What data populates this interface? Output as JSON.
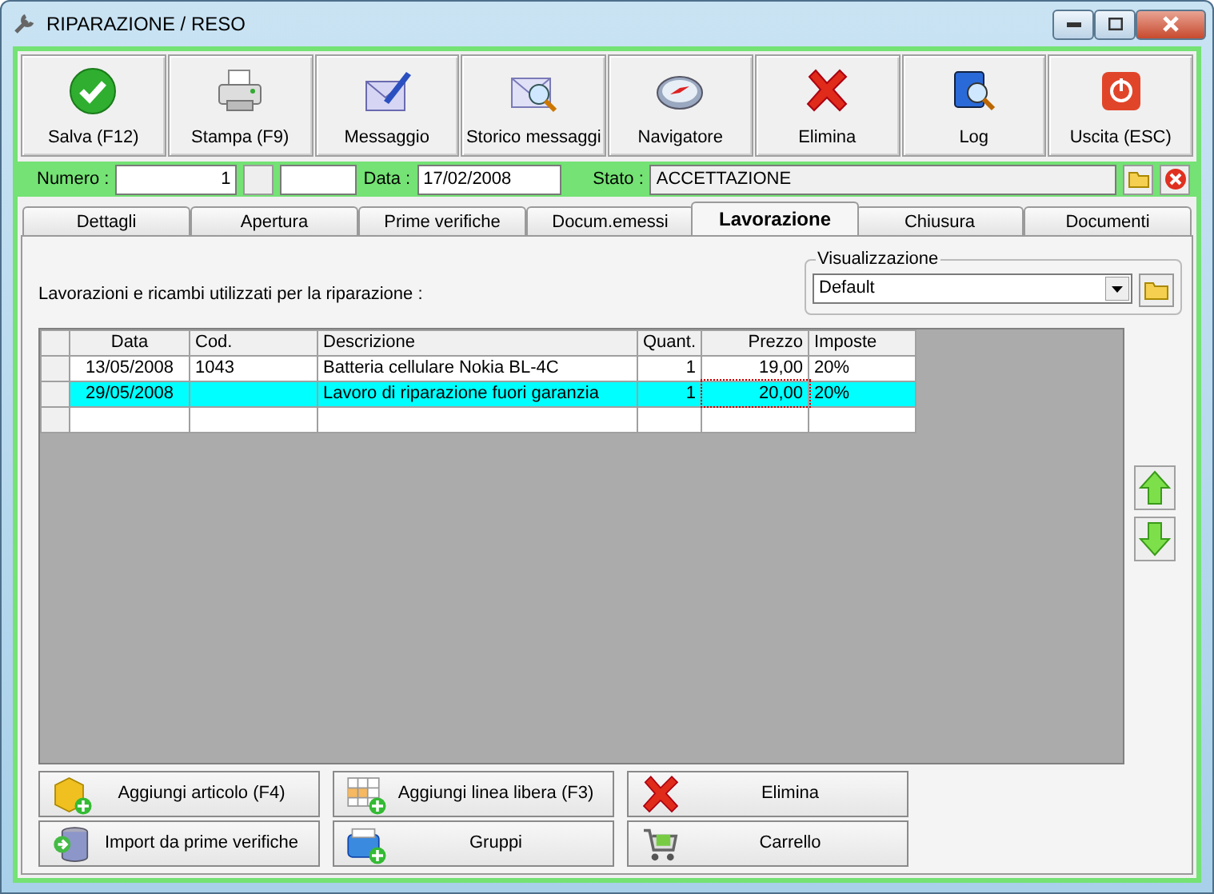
{
  "window": {
    "title": "RIPARAZIONE / RESO"
  },
  "toolbar": [
    {
      "label": "Salva (F12)",
      "kind": "check"
    },
    {
      "label": "Stampa (F9)",
      "kind": "printer"
    },
    {
      "label": "Messaggio",
      "kind": "mail-pen"
    },
    {
      "label": "Storico messaggi",
      "kind": "mail-search"
    },
    {
      "label": "Navigatore",
      "kind": "compass"
    },
    {
      "label": "Elimina",
      "kind": "cross"
    },
    {
      "label": "Log",
      "kind": "book-search"
    },
    {
      "label": "Uscita (ESC)",
      "kind": "power"
    }
  ],
  "record": {
    "numero_label": "Numero :",
    "numero": "1",
    "data_label": "Data :",
    "data": "17/02/2008",
    "stato_label": "Stato :",
    "stato": "ACCETTAZIONE"
  },
  "tabs": [
    {
      "label": "Dettagli",
      "selected": false
    },
    {
      "label": "Apertura",
      "selected": false
    },
    {
      "label": "Prime verifiche",
      "selected": false
    },
    {
      "label": "Docum.emessi",
      "selected": false
    },
    {
      "label": "Lavorazione",
      "selected": true
    },
    {
      "label": "Chiusura",
      "selected": false
    },
    {
      "label": "Documenti",
      "selected": false
    }
  ],
  "caption": "Lavorazioni e ricambi utilizzati per la riparazione :",
  "view": {
    "legend": "Visualizzazione",
    "value": "Default"
  },
  "table": {
    "columns": [
      "Data",
      "Cod.",
      "Descrizione",
      "Quant.",
      "Prezzo",
      "Imposte"
    ],
    "rows": [
      {
        "cells": [
          "13/05/2008",
          "1043",
          "Batteria cellulare Nokia BL-4C",
          "1",
          "19,00",
          "20%"
        ],
        "selected": false
      },
      {
        "cells": [
          "29/05/2008",
          "",
          "Lavoro di riparazione fuori garanzia",
          "1",
          "20,00",
          "20%"
        ],
        "selected": true
      }
    ]
  },
  "actions": [
    {
      "label": "Aggiungi articolo (F4)",
      "kind": "box-add"
    },
    {
      "label": "Aggiungi linea libera (F3)",
      "kind": "grid-add"
    },
    {
      "label": "Elimina",
      "kind": "cross"
    },
    {
      "label": "Import da prime verifiche",
      "kind": "db-import"
    },
    {
      "label": "Gruppi",
      "kind": "group-add"
    },
    {
      "label": "Carrello",
      "kind": "cart"
    }
  ]
}
